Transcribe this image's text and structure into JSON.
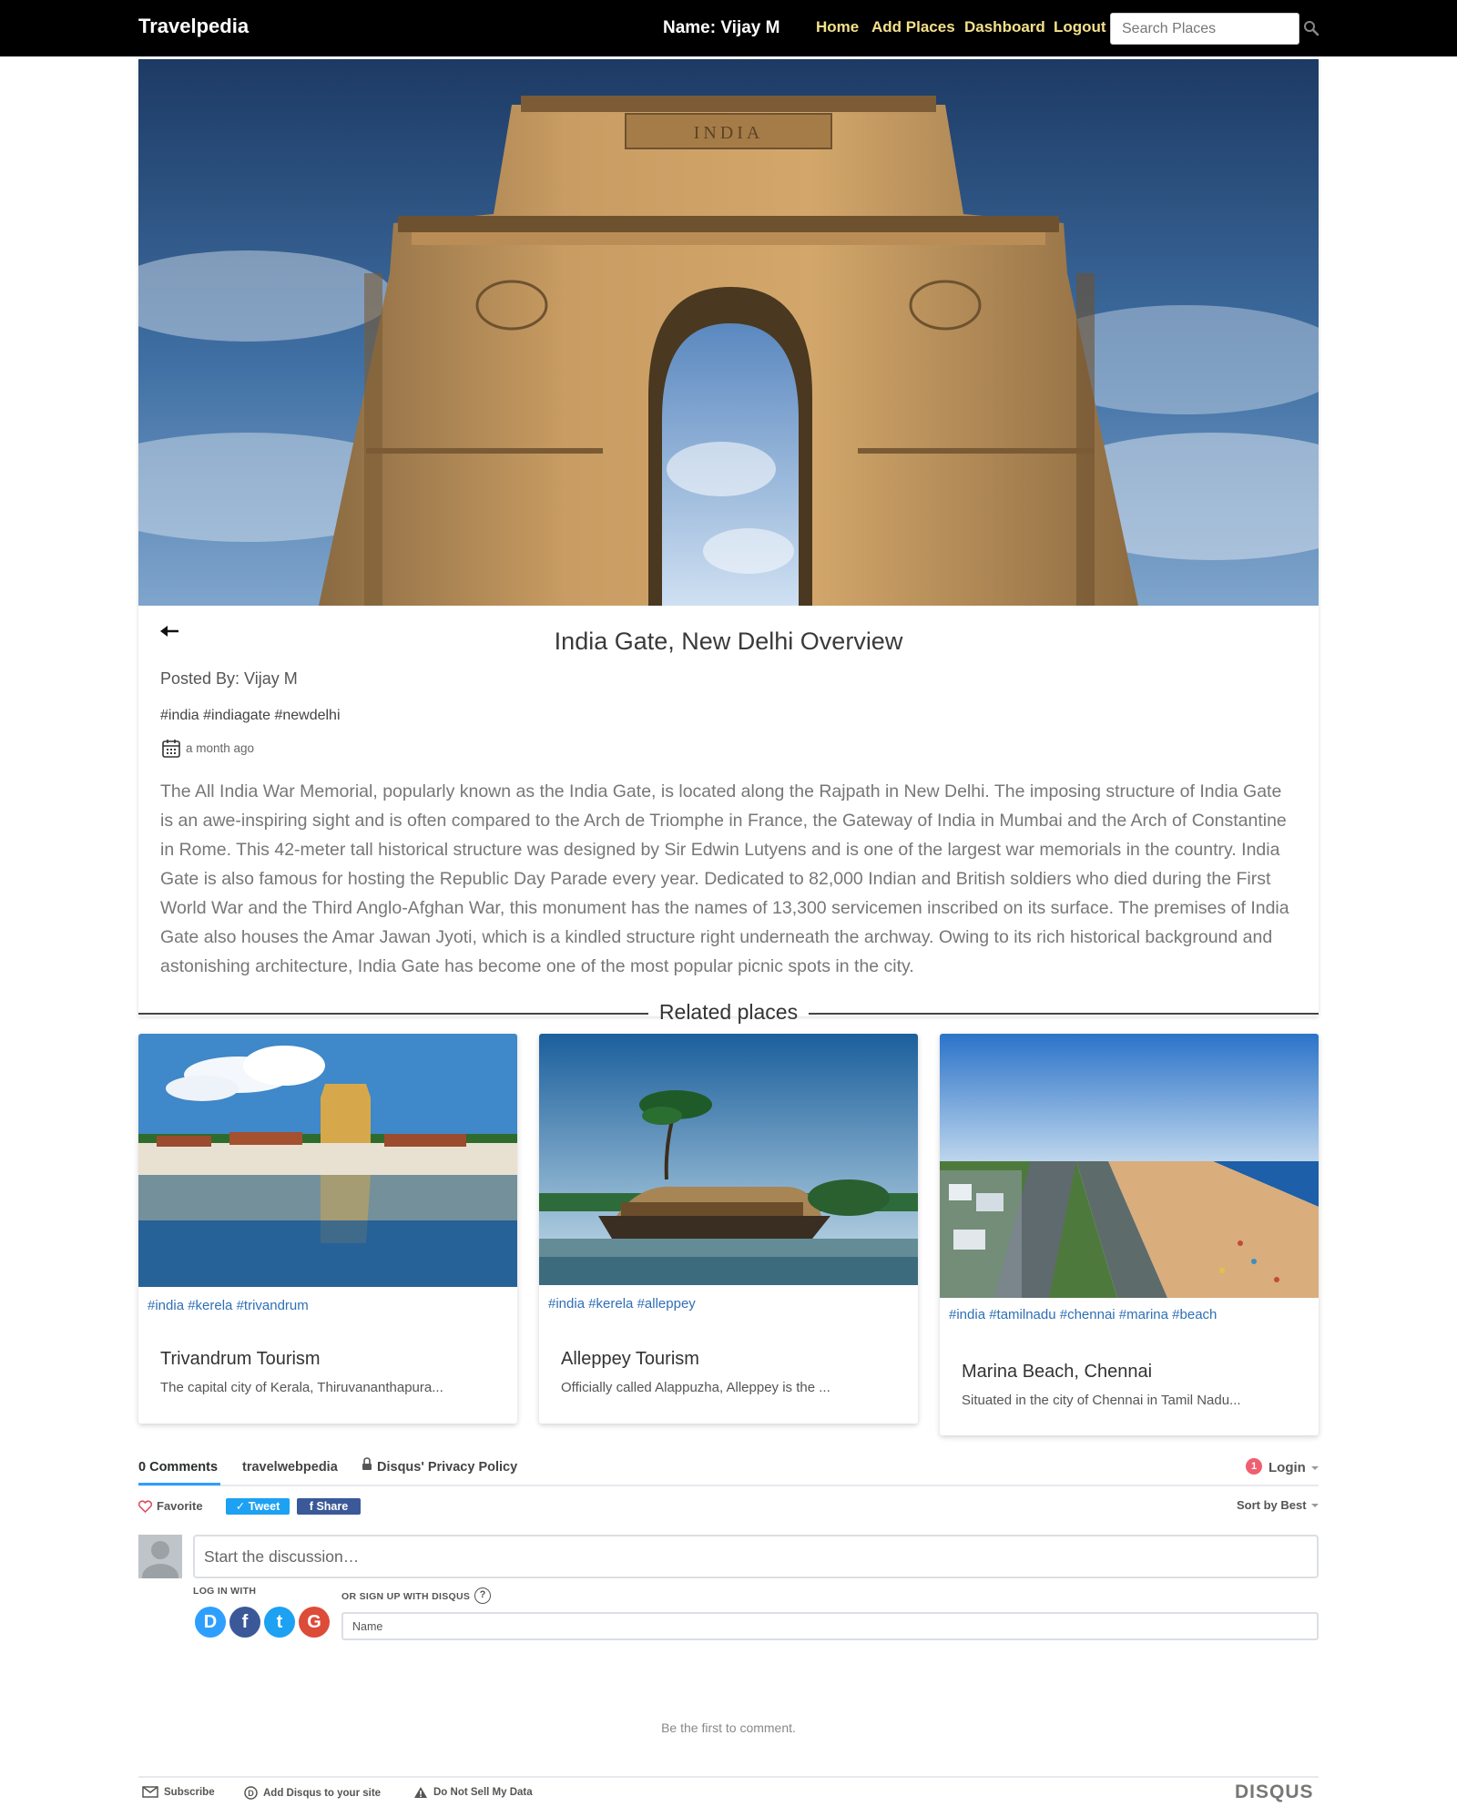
{
  "navbar": {
    "brand": "Travelpedia",
    "user": "Name: Vijay M",
    "links": {
      "home": "Home",
      "add_places": "Add Places",
      "dashboard": "Dashboard",
      "logout": "Logout"
    },
    "search_placeholder": "Search Places"
  },
  "place": {
    "title": "India Gate, New Delhi Overview",
    "posted_by": "Posted By: Vijay M",
    "tags": "#india #indiagate #newdelhi",
    "time": "a month ago",
    "description": "The All India War Memorial, popularly known as the India Gate, is located along the Rajpath in New Delhi. The imposing structure of India Gate is an awe-inspiring sight and is often compared to the Arch de Triomphe in France, the Gateway of India in Mumbai and the Arch of Constantine in Rome. This 42-meter tall historical structure was designed by Sir Edwin Lutyens and is one of the largest war memorials in the country. India Gate is also famous for hosting the Republic Day Parade every year. Dedicated to 82,000 Indian and British soldiers who died during the First World War and the Third Anglo-Afghan War, this monument has the names of 13,300 servicemen inscribed on its surface. The premises of India Gate also houses the Amar Jawan Jyoti, which is a kindled structure right underneath the archway. Owing to its rich historical background and astonishing architecture, India Gate has become one of the most popular picnic spots in the city.",
    "hero_arch_text": "INDIA"
  },
  "related": {
    "heading": "Related places",
    "cards": [
      {
        "tags": "#india #kerela #trivandrum",
        "title": "Trivandrum Tourism",
        "desc": "The capital city of Kerala, Thiruvananthapura..."
      },
      {
        "tags": "#india #kerela #alleppey",
        "title": "Alleppey Tourism",
        "desc": "Officially called Alappuzha, Alleppey is the ..."
      },
      {
        "tags": "#india #tamilnadu #chennai #marina #beach",
        "title": "Marina Beach, Chennai",
        "desc": "Situated in the city of Chennai in Tamil Nadu..."
      }
    ]
  },
  "disqus": {
    "tabs": {
      "comments": "0 Comments",
      "site": "travelwebpedia",
      "privacy": "Disqus' Privacy Policy"
    },
    "badge": "1",
    "login": "Login",
    "favorite": "Favorite",
    "tweet": "Tweet",
    "share": "Share",
    "sort": "Sort by Best",
    "discussion_placeholder": "Start the discussion…",
    "log_in_with": "LOG IN WITH",
    "or_sign_up": "OR SIGN UP WITH DISQUS",
    "help": "?",
    "social": {
      "disqus": "D",
      "facebook": "f",
      "twitter": "t",
      "google": "G"
    },
    "name_placeholder": "Name",
    "empty": "Be the first to comment.",
    "footer": {
      "subscribe": "Subscribe",
      "add": "Add Disqus to your site",
      "dnsmpi": "Do Not Sell My Data",
      "logo": "DISQUS"
    }
  },
  "colors": {
    "navbar_bg": "#000000",
    "nav_link": "#f3e08a",
    "tag_link": "#2f6fb5",
    "disqus_blue": "#2e9fff",
    "twitter": "#1da1f2",
    "facebook": "#3b5998",
    "google": "#dd4b39"
  }
}
